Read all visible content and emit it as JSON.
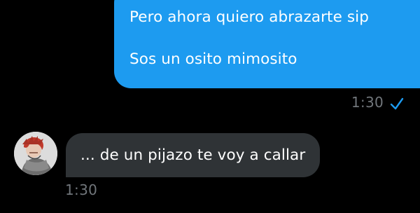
{
  "messages": {
    "outgoing": {
      "line1": "Pero ahora quiero abrazarte sip",
      "line2": "Sos un osito mimosito",
      "time": "1:30",
      "status_icon": "check-icon",
      "bubble_color": "#1d9bf0"
    },
    "incoming": {
      "text": "... de un pijazo te voy a callar",
      "time": "1:30",
      "bubble_color": "#2f3336"
    }
  },
  "colors": {
    "background": "#000000",
    "timestamp": "#71767b",
    "check": "#1d9bf0"
  }
}
